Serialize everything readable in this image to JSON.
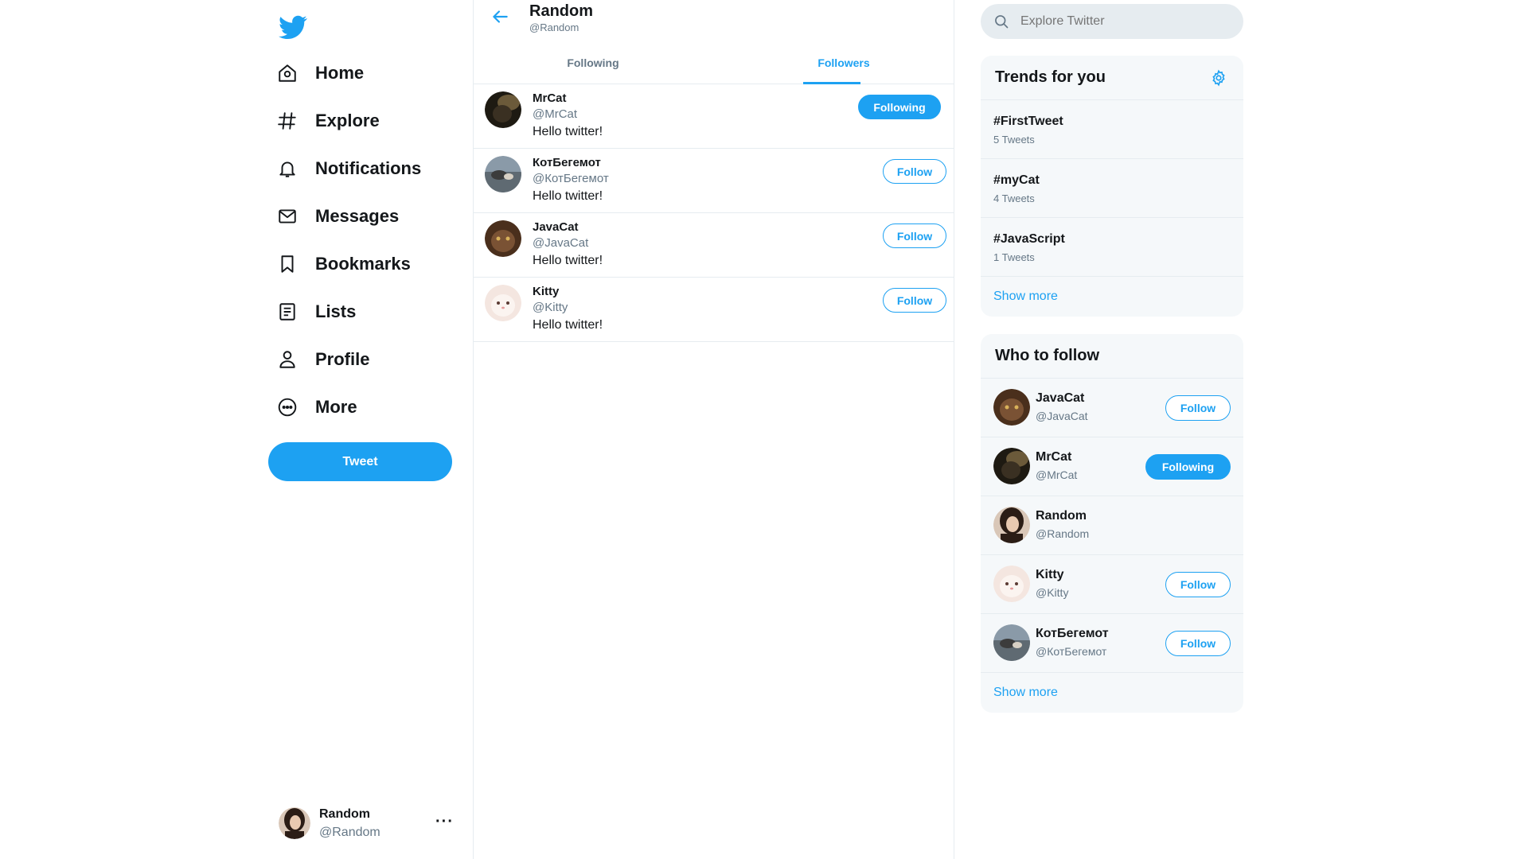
{
  "sidebar": {
    "logo_icon": "twitter-bird-icon",
    "nav": [
      {
        "label": "Home",
        "icon": "home-icon"
      },
      {
        "label": "Explore",
        "icon": "hashtag-icon"
      },
      {
        "label": "Notifications",
        "icon": "bell-icon"
      },
      {
        "label": "Messages",
        "icon": "envelope-icon"
      },
      {
        "label": "Bookmarks",
        "icon": "bookmark-icon"
      },
      {
        "label": "Lists",
        "icon": "list-icon"
      },
      {
        "label": "Profile",
        "icon": "person-icon"
      },
      {
        "label": "More",
        "icon": "more-circle-icon"
      }
    ],
    "tweet_button": "Tweet",
    "account": {
      "name": "Random",
      "handle": "@Random",
      "more": "···"
    }
  },
  "main": {
    "title": "Random",
    "subtitle": "@Random",
    "tabs": [
      {
        "label": "Following",
        "active": false
      },
      {
        "label": "Followers",
        "active": true
      }
    ],
    "users": [
      {
        "name": "MrCat",
        "handle": "@MrCat",
        "bio": "Hello twitter!",
        "button": "Following",
        "following": true
      },
      {
        "name": "КотБегемот",
        "handle": "@КотБегемот",
        "bio": "Hello twitter!",
        "button": "Follow",
        "following": false
      },
      {
        "name": "JavaCat",
        "handle": "@JavaCat",
        "bio": "Hello twitter!",
        "button": "Follow",
        "following": false
      },
      {
        "name": "Kitty",
        "handle": "@Kitty",
        "bio": "Hello twitter!",
        "button": "Follow",
        "following": false
      }
    ]
  },
  "right": {
    "search_placeholder": "Explore Twitter",
    "trends": {
      "title": "Trends for you",
      "items": [
        {
          "tag": "#FirstTweet",
          "count": "5 Tweets"
        },
        {
          "tag": "#myCat",
          "count": "4 Tweets"
        },
        {
          "tag": "#JavaScript",
          "count": "1 Tweets"
        }
      ],
      "show_more": "Show more"
    },
    "who_to_follow": {
      "title": "Who to follow",
      "items": [
        {
          "name": "JavaCat",
          "handle": "@JavaCat",
          "button": "Follow",
          "following": false
        },
        {
          "name": "MrCat",
          "handle": "@MrCat",
          "button": "Following",
          "following": true
        },
        {
          "name": "Random",
          "handle": "@Random",
          "button": "",
          "following": false
        },
        {
          "name": "Kitty",
          "handle": "@Kitty",
          "button": "Follow",
          "following": false
        },
        {
          "name": "КотБегемот",
          "handle": "@КотБегемот",
          "button": "Follow",
          "following": false
        }
      ],
      "show_more": "Show more"
    }
  },
  "colors": {
    "accent": "#1da1f2",
    "text_primary": "#14171a",
    "text_secondary": "#657786",
    "border": "#e6ecf0",
    "card_bg": "#f5f8fa"
  }
}
